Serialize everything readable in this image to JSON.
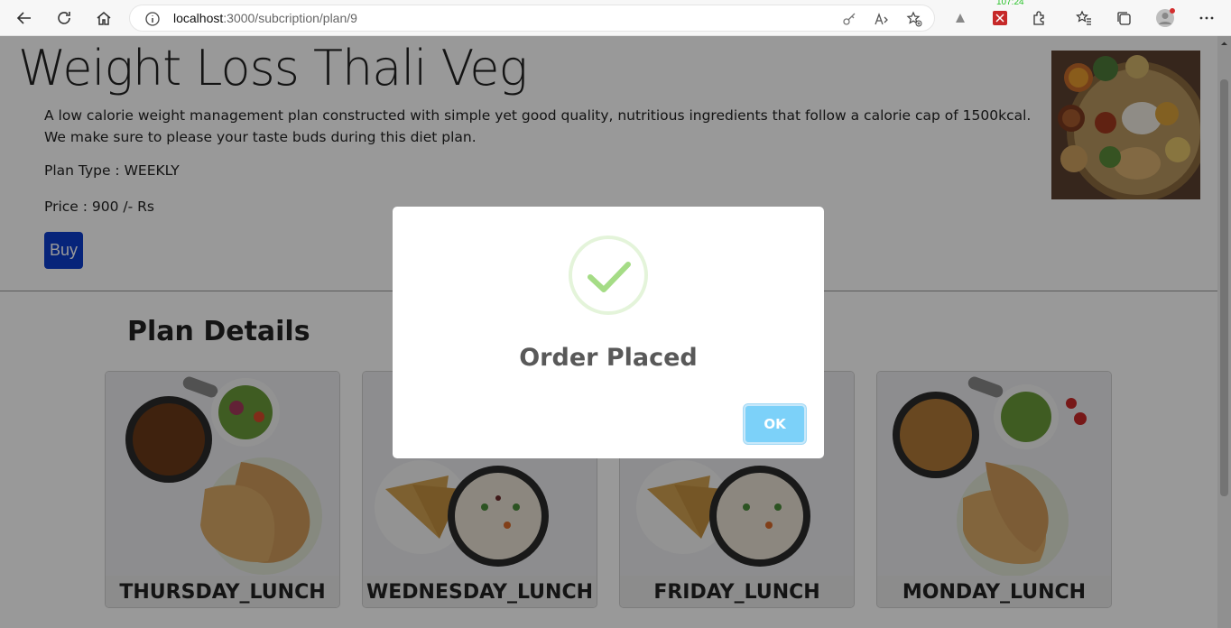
{
  "browser": {
    "url_host": "localhost",
    "url_path": ":3000/subcription/plan/9",
    "clock": "107:24"
  },
  "plan": {
    "title": "Weight Loss Thali Veg",
    "description": "A low calorie weight management plan constructed with simple yet good quality, nutritious ingredients that follow a calorie cap of 1500kcal. We make sure to please your taste buds during this diet plan.",
    "plan_type": "Plan Type : WEEKLY",
    "price": "Price : 900 /- Rs",
    "buy_label": "Buy"
  },
  "details": {
    "title": "Plan Details",
    "cards": [
      {
        "label": "THURSDAY_LUNCH"
      },
      {
        "label": "WEDNESDAY_LUNCH"
      },
      {
        "label": "FRIDAY_LUNCH"
      },
      {
        "label": "MONDAY_LUNCH"
      }
    ]
  },
  "modal": {
    "title": "Order Placed",
    "ok_label": "OK"
  }
}
